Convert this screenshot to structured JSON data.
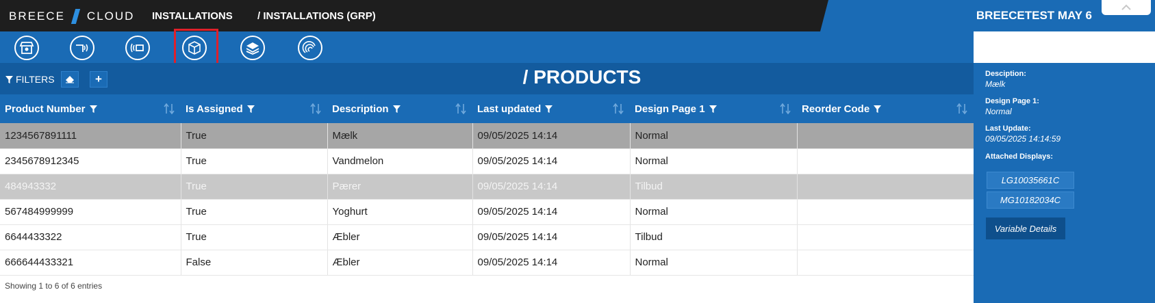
{
  "app": {
    "logo_left": "BREECE",
    "logo_right": "CLOUD",
    "breadcrumb": [
      "INSTALLATIONS",
      "/ INSTALLATIONS (GRP)"
    ],
    "tenant": "BREECETEST MAY 6"
  },
  "toolbar": {
    "icons": [
      "store-icon",
      "signal-display-icon",
      "nfc-tag-icon",
      "product-box-icon",
      "layers-icon",
      "gateway-icon"
    ],
    "selected": "product-box-icon"
  },
  "filterbar": {
    "filters_label": "FILTERS",
    "title": "/ PRODUCTS"
  },
  "table": {
    "columns": [
      "Product Number",
      "Is Assigned",
      "Description",
      "Last updated",
      "Design Page 1",
      "Reorder Code"
    ],
    "rows": [
      [
        "1234567891111",
        "True",
        "Mælk",
        "09/05/2025 14:14",
        "Normal",
        ""
      ],
      [
        "2345678912345",
        "True",
        "Vandmelon",
        "09/05/2025 14:14",
        "Normal",
        ""
      ],
      [
        "484943332",
        "True",
        "Pærer",
        "09/05/2025 14:14",
        "Tilbud",
        ""
      ],
      [
        "567484999999",
        "True",
        "Yoghurt",
        "09/05/2025 14:14",
        "Normal",
        ""
      ],
      [
        "6644433322",
        "True",
        "Æbler",
        "09/05/2025 14:14",
        "Tilbud",
        ""
      ],
      [
        "666644433321",
        "False",
        "Æbler",
        "09/05/2025 14:14",
        "Normal",
        ""
      ]
    ],
    "footer": "Showing 1 to 6 of 6 entries"
  },
  "details": {
    "description_label": "Desciption:",
    "description_value": "Mælk",
    "design_label": "Design Page 1:",
    "design_value": "Normal",
    "last_update_label": "Last Update:",
    "last_update_value": "09/05/2025 14:14:59",
    "attached_label": "Attached Displays:",
    "displays": [
      "LG10035661C",
      "MG10182034C"
    ],
    "variable_button": "Variable Details"
  },
  "colors": {
    "brand_blue": "#1a6bb5",
    "dark_blue": "#135b9e",
    "topbar_dark": "#1e1e1e",
    "selection_red": "#e0202a"
  }
}
